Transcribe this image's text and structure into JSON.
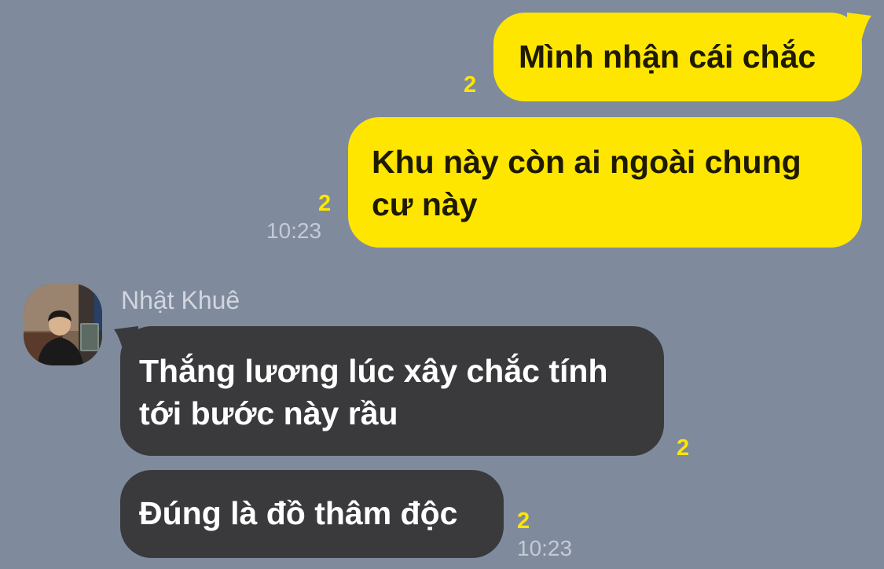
{
  "conversation": {
    "sent": [
      {
        "text": "Mình nhận cái chắc",
        "read_count": "2"
      },
      {
        "text": "Khu này còn ai ngoài chung cư này",
        "read_count": "2",
        "time": "10:23"
      }
    ],
    "received": {
      "sender_name": "Nhật Khuê",
      "messages": [
        {
          "text": "Thắng lương lúc xây chắc tính tới bước này rầu",
          "read_count": "2"
        },
        {
          "text": "Đúng là đồ thâm độc",
          "read_count": "2",
          "time": "10:23"
        }
      ]
    }
  },
  "colors": {
    "background": "#7f8b9d",
    "sent_bubble": "#ffe600",
    "received_bubble": "#3a3a3d",
    "read_count": "#ffe600",
    "timestamp": "#c4cad5",
    "sender_name": "#d2d6de"
  }
}
